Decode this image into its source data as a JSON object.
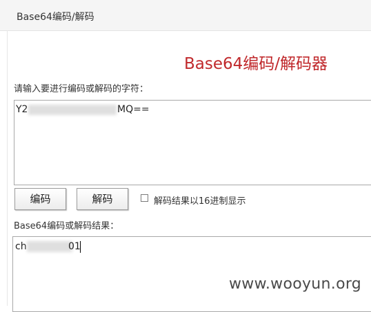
{
  "header": {
    "title": "Base64编码/解码"
  },
  "main": {
    "title": "Base64编码/解码器",
    "input_label": "请输入要进行编码或解码的字符：",
    "input_value_prefix": "Y2",
    "input_value_suffix": "MQ==",
    "encode_button": "编码",
    "decode_button": "解码",
    "hex_checkbox_label": "解码结果以16进制显示",
    "hex_checkbox_checked": false,
    "result_label": "Base64编码或解码结果：",
    "result_value_prefix": "ch",
    "result_value_suffix": "01"
  },
  "watermark": "www.wooyun.org"
}
